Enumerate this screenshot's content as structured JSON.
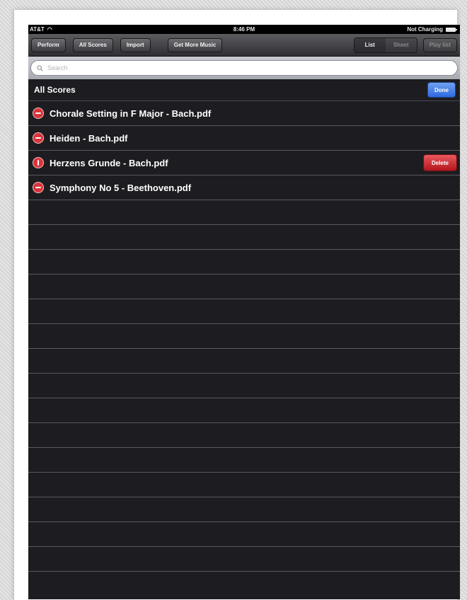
{
  "status_bar": {
    "carrier": "AT&T",
    "time": "8:46 PM",
    "charging": "Not Charging"
  },
  "toolbar": {
    "perform": "Perform",
    "all_scores": "All Scores",
    "import": "Import",
    "get_more_music": "Get More Music",
    "view_list": "List",
    "view_sheet": "Sheet",
    "play_list": "Play list"
  },
  "search": {
    "placeholder": "Search"
  },
  "section": {
    "title": "All Scores",
    "done_label": "Done"
  },
  "scores": [
    {
      "name": "Chorale Setting in F Major - Bach.pdf"
    },
    {
      "name": "Heiden - Bach.pdf"
    },
    {
      "name": "Herzens Grunde - Bach.pdf",
      "delete_label": "Delete"
    },
    {
      "name": "Symphony No 5 - Beethoven.pdf"
    }
  ],
  "colors": {
    "background": "#1d1d21",
    "done_blue": "#2d6ae0",
    "delete_red": "#b4161c"
  }
}
